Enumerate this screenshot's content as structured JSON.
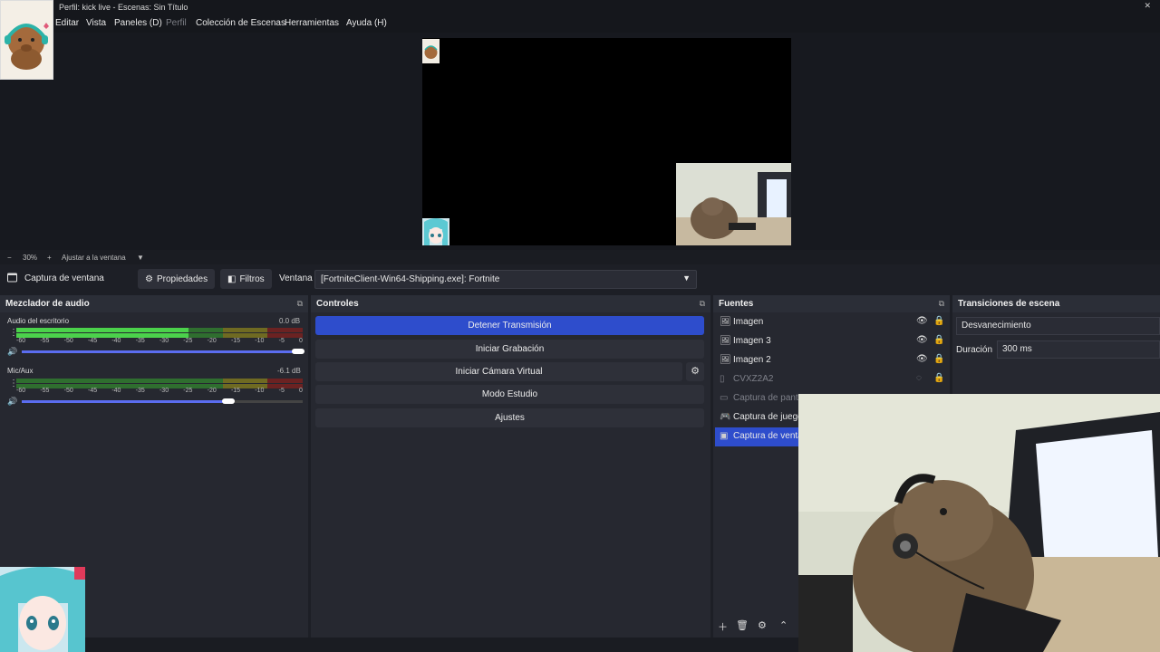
{
  "window": {
    "title": "Perfil: kick live - Escenas: Sin Título",
    "close_glyph": "✕"
  },
  "menu": {
    "items": [
      "Editar",
      "Vista",
      "Paneles (D)",
      "Perfil",
      "Colección de Escenas",
      "Herramientas",
      "Ayuda (H)"
    ]
  },
  "zoom": {
    "minus": "−",
    "value": "30%",
    "plus": "+",
    "fit": "Ajustar a la ventana",
    "arrow": "▼"
  },
  "context": {
    "source_name": "Captura de ventana",
    "properties": "Propiedades",
    "filters": "Filtros",
    "window_label": "Ventana",
    "window_value": "[FortniteClient-Win64-Shipping.exe]: Fortnite"
  },
  "mixer": {
    "title": "Mezclador de audio",
    "ticks": [
      "-60",
      "-55",
      "-50",
      "-45",
      "-40",
      "-35",
      "-30",
      "-25",
      "-20",
      "-15",
      "-10",
      "-5",
      "0"
    ],
    "channels": [
      {
        "name": "Audio del escritorio",
        "db": "0.0 dB",
        "level": 0.6,
        "volume": 1.0
      },
      {
        "name": "Mic/Aux",
        "db": "-6.1 dB",
        "level": 0.0,
        "volume": 0.75
      }
    ]
  },
  "controls": {
    "title": "Controles",
    "stop_stream": "Detener Transmisión",
    "start_recording": "Iniciar Grabación",
    "virtual_cam": "Iniciar Cámara Virtual",
    "studio_mode": "Modo Estudio",
    "settings": "Ajustes"
  },
  "sources": {
    "title": "Fuentes",
    "items": [
      {
        "label": "Imagen",
        "icon": "image-icon",
        "visible": true
      },
      {
        "label": "Imagen 3",
        "icon": "image-icon",
        "visible": true
      },
      {
        "label": "Imagen 2",
        "icon": "image-icon",
        "visible": true
      },
      {
        "label": "CVXZ2A2",
        "icon": "file-icon",
        "visible": false
      },
      {
        "label": "Captura de panta",
        "icon": "monitor-icon",
        "visible": false
      },
      {
        "label": "Captura de juego",
        "icon": "gamepad-icon",
        "visible": true
      },
      {
        "label": "Captura de venta",
        "icon": "window-icon",
        "visible": true,
        "selected": true
      }
    ]
  },
  "transitions": {
    "title": "Transiciones de escena",
    "type": "Desvanecimiento",
    "duration_label": "Duración",
    "duration_value": "300 ms"
  },
  "colors": {
    "accent": "#2e4dcc",
    "meter_green": "#4bd24b"
  }
}
